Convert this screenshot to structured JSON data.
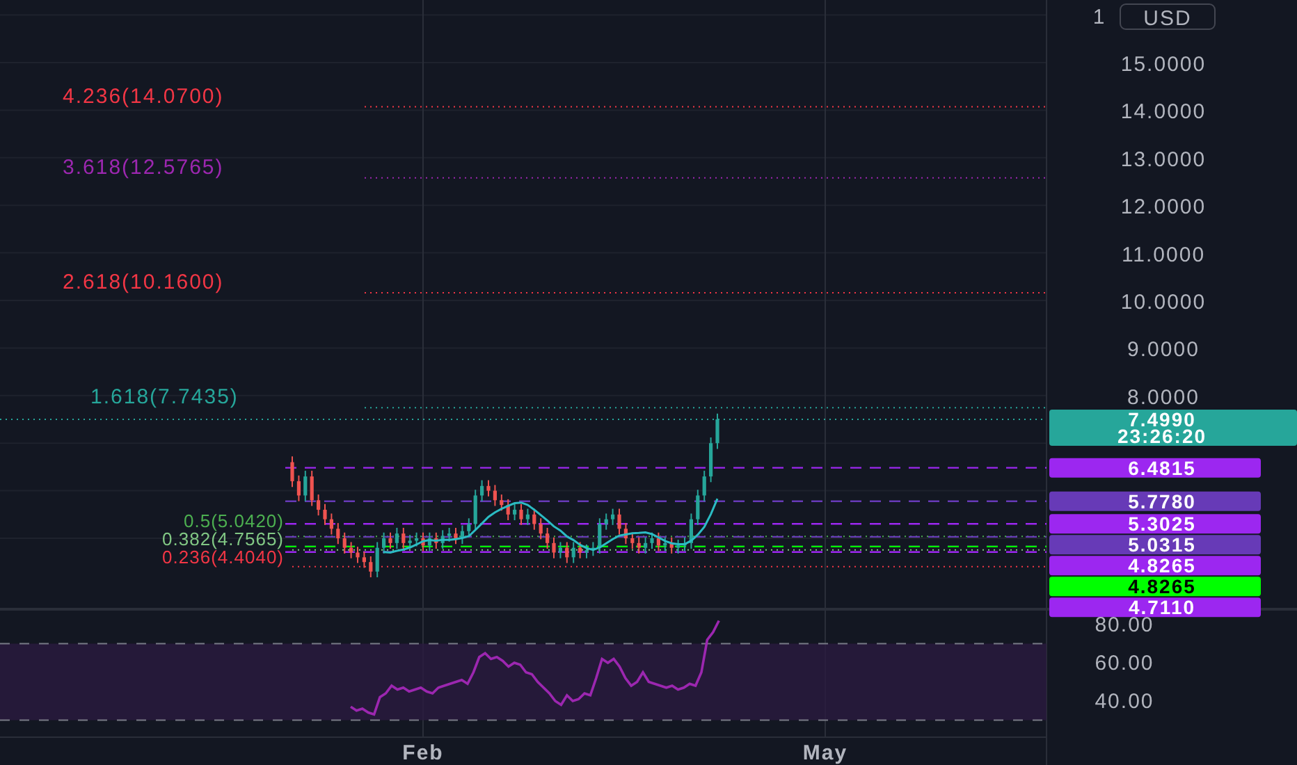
{
  "currency_button": "USD",
  "price_axis": {
    "labels": [
      "1",
      "15.0000",
      "14.0000",
      "13.0000",
      "12.0000",
      "11.0000",
      "10.0000",
      "9.0000",
      "8.0000"
    ]
  },
  "fib_levels": [
    {
      "label": "4.236(14.0700)",
      "color": "#f23645"
    },
    {
      "label": "3.618(12.5765)",
      "color": "#9c27b0"
    },
    {
      "label": "2.618(10.1600)",
      "color": "#f23645"
    },
    {
      "label": "1.618(7.7435)",
      "color": "#26a69a"
    },
    {
      "label": "0.5(5.0420)",
      "color": "#4caf50"
    },
    {
      "label": "0.382(4.7565)",
      "color": "#81c784"
    },
    {
      "label": "0.236(4.4040)",
      "color": "#f23645"
    }
  ],
  "price_tags": [
    {
      "text": "7.4990",
      "countdown": "23:26:20",
      "color": "#26a69a"
    },
    {
      "text": "6.4815",
      "color": "#9c27f0"
    },
    {
      "text": "5.7780",
      "color": "#673ab7"
    },
    {
      "text": "5.3025",
      "color": "#9c27f0"
    },
    {
      "text": "5.0315",
      "color": "#673ab7"
    },
    {
      "text": "4.8265",
      "color": "#9c27f0"
    },
    {
      "text": "4.8265",
      "color": "#00ff00"
    },
    {
      "text": "4.7110",
      "color": "#9c27f0"
    }
  ],
  "rsi_axis": [
    "80.00",
    "60.00",
    "40.00"
  ],
  "time_axis": [
    "Feb",
    "May"
  ]
}
